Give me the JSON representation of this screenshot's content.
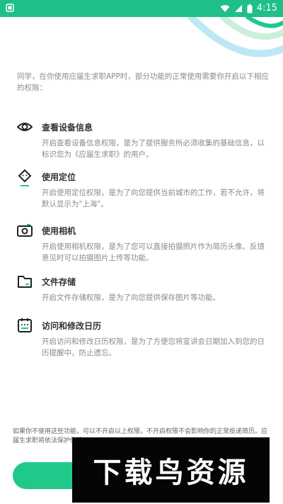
{
  "status_bar": {
    "time": "4:15",
    "icons": [
      "app-notification-icon",
      "wifi-icon",
      "signal-icon",
      "battery-icon"
    ]
  },
  "intro": "同学，在你使用应届生求职APP时，部分功能的正常使用需要你开启以下相应的权限：",
  "permissions": [
    {
      "icon": "eye-icon",
      "title": "查看设备信息",
      "desc": "开启查看设备信息权限，是为了提供服务所必须收集的基础信息，以标识您为《应届生求职》的用户。"
    },
    {
      "icon": "location-icon",
      "title": "使用定位",
      "desc": "开启使用定位权限，是为了向您提供当前城市的工作，若不允许，将默认显示为\"上海\"。"
    },
    {
      "icon": "camera-icon",
      "title": "使用相机",
      "desc": "开启使用相机权限，是为了您可以直接拍摄照片作为简历头像、反馈意见时可以拍摄图片上传等功能。"
    },
    {
      "icon": "folder-icon",
      "title": "文件存储",
      "desc": "开启文件存储权限，是为了向您提供保存图片等功能。"
    },
    {
      "icon": "calendar-icon",
      "title": "访问和修改日历",
      "desc": "开启访问和修改日历权限，是为了方便您将宣讲会日期加入到您的日历提醒中，防止遗忘。"
    }
  ],
  "footer_note": "如果你不使用这些功能，可以不开启以上权限，不开启权限不会影响你的正常投递简历。应届生求职将依法保护你的",
  "watermark": "下载鸟资源",
  "colors": {
    "accent": "#1fbf8a",
    "button": "#20c98a"
  }
}
